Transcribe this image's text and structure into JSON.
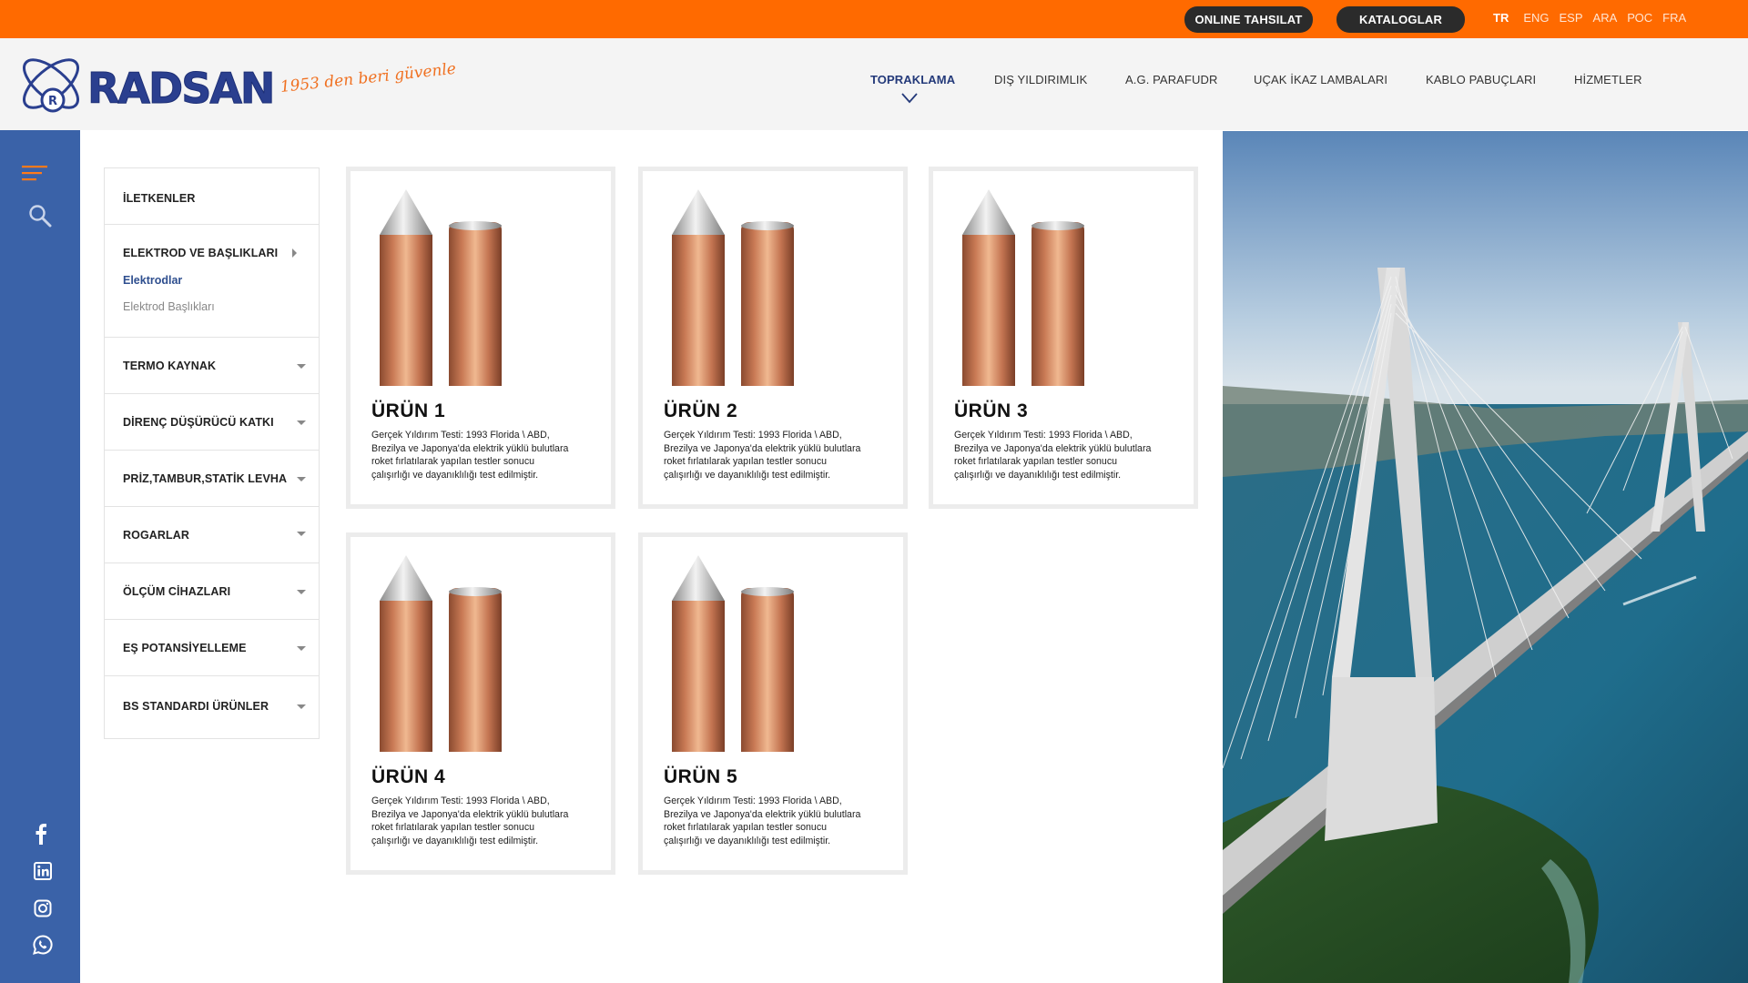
{
  "topbar": {
    "online_label": "ONLINE TAHSILAT",
    "catalog_label": "KATALOGLAR",
    "languages": [
      "TR",
      "ENG",
      "ESP",
      "ARA",
      "РОС",
      "FRA"
    ]
  },
  "brand": {
    "name": "RADSAN",
    "slogan": "1953 den beri güvenle"
  },
  "nav": {
    "items": [
      "TOPRAKLAMA",
      "DIŞ YILDIRIMLIK",
      "A.G. PARAFUDR",
      "UÇAK İKAZ LAMBALARI",
      "KABLO PABUÇLARI",
      "HİZMETLER"
    ],
    "active_index": 0
  },
  "rail": {
    "icons": [
      "menu-icon",
      "search-icon"
    ],
    "social": [
      "facebook-icon",
      "linkedin-icon",
      "instagram-icon",
      "whatsapp-icon"
    ]
  },
  "categories": [
    {
      "label": "İLETKENLER"
    },
    {
      "label": "ELEKTROD VE BAŞLIKLARI",
      "expanded": true,
      "children": [
        "Elektrodlar",
        "Elektrod Başlıkları"
      ],
      "active_child": 0
    },
    {
      "label": "TERMO KAYNAK"
    },
    {
      "label": "DİRENÇ DÜŞÜRÜCÜ KATKI"
    },
    {
      "label": "PRİZ,TAMBUR,STATİK LEVHA"
    },
    {
      "label": "ROGARLAR"
    },
    {
      "label": "ÖLÇÜM CİHAZLARI"
    },
    {
      "label": "EŞ POTANSİYELLEME"
    },
    {
      "label": "BS STANDARDI ÜRÜNLER"
    }
  ],
  "products": [
    {
      "title": "ÜRÜN 1",
      "desc": "Gerçek Yıldırım Testi: 1993 Florida \\ ABD, Brezilya ve Japonya'da elektrik yüklü bulutlara roket fırlatılarak yapılan testler sonucu çalışırlığı ve dayanıklılığı test edilmiştir."
    },
    {
      "title": "ÜRÜN 2",
      "desc": "Gerçek Yıldırım Testi: 1993 Florida \\ ABD, Brezilya ve Japonya'da elektrik yüklü bulutlara roket fırlatılarak yapılan testler sonucu çalışırlığı ve dayanıklılığı test edilmiştir."
    },
    {
      "title": "ÜRÜN 3",
      "desc": "Gerçek Yıldırım Testi: 1993 Florida \\ ABD, Brezilya ve Japonya'da elektrik yüklü bulutlara roket fırlatılarak yapılan testler sonucu çalışırlığı ve dayanıklılığı test edilmiştir."
    },
    {
      "title": "ÜRÜN 4",
      "desc": "Gerçek Yıldırım Testi: 1993 Florida \\ ABD, Brezilya ve Japonya'da elektrik yüklü bulutlara roket fırlatılarak yapılan testler sonucu çalışırlığı ve dayanıklılığı test edilmiştir."
    },
    {
      "title": "ÜRÜN 5",
      "desc": "Gerçek Yıldırım Testi: 1993 Florida \\ ABD, Brezilya ve Japonya'da elektrik yüklü bulutlara roket fırlatılarak yapılan testler sonucu çalışırlığı ve dayanıklılığı test edilmiştir."
    }
  ],
  "colors": {
    "accent": "#ff6a00",
    "rail": "#3a62a8",
    "nav_active": "#243a7a"
  }
}
